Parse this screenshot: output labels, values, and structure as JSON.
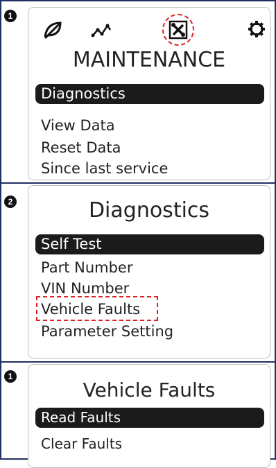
{
  "panel1": {
    "step": "1",
    "icons": [
      "leaf-icon",
      "graph-icon",
      "wrench-screwdriver-icon",
      "gear-icon"
    ],
    "title": "MAINTENANCE",
    "items": [
      "Diagnostics",
      "View Data",
      "Reset Data",
      "Since last service"
    ]
  },
  "panel2": {
    "step": "2",
    "title": "Diagnostics",
    "items": [
      "Self Test",
      "Part Number",
      "VIN Number",
      "Vehicle Faults",
      "Parameter Setting"
    ]
  },
  "panel3": {
    "step": "1",
    "title": "Vehicle Faults",
    "items": [
      "Read Faults",
      "Clear Faults"
    ]
  },
  "colors": {
    "frame": "#1f2f63",
    "highlight": "#d22222",
    "selected_bg": "#1b1b1b"
  }
}
